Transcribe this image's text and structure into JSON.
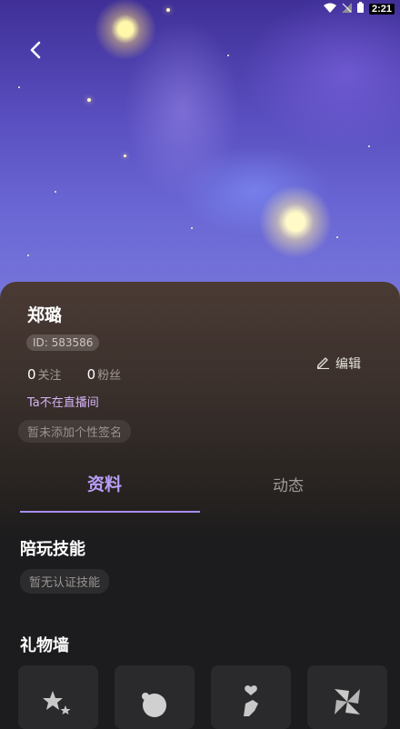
{
  "status": {
    "time": "2:21"
  },
  "profile": {
    "name": "郑璐",
    "id_text": "ID: 583586",
    "following_count": "0",
    "following_label": "关注",
    "fans_count": "0",
    "fans_label": "粉丝",
    "live_status": "Ta不在直播间",
    "signature": "暂未添加个性签名",
    "edit_label": "编辑"
  },
  "tabs": [
    {
      "label": "资料",
      "active": true
    },
    {
      "label": "动态",
      "active": false
    }
  ],
  "skills": {
    "title": "陪玩技能",
    "empty_text": "暂无认证技能"
  },
  "gift_wall": {
    "title": "礼物墙",
    "items": [
      {
        "icon": "stars-icon"
      },
      {
        "icon": "planet-icon"
      },
      {
        "icon": "heart-hand-icon"
      },
      {
        "icon": "pinwheel-icon"
      }
    ]
  },
  "colors": {
    "accent": "#b99ef6",
    "live": "#d6b3f4"
  }
}
